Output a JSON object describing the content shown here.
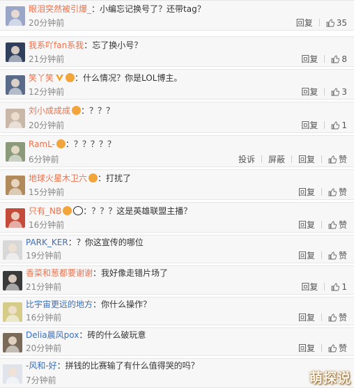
{
  "comments": [
    {
      "username": "眼泪突然被引爆_",
      "badge": "none",
      "text": "：小编忘记换号了？还带tag？",
      "time": "20分钟前",
      "actions": [
        "回复"
      ],
      "likes": "35",
      "avatar_color": "#9aa6c8",
      "avatar_icon": "anime-avatar-icon"
    },
    {
      "username": "我系吖fan系我",
      "badge": "none",
      "text": "：忘了换小号？",
      "time": "21分钟前",
      "actions": [
        "回复"
      ],
      "likes": "8",
      "avatar_color": "#2f3f5c",
      "avatar_icon": "crest-avatar-icon"
    },
    {
      "username": "笑丫笑",
      "badge": "vip",
      "text": "：什么情况？你是LOL博主。",
      "time": "12分钟前",
      "actions": [
        "回复"
      ],
      "likes": "3",
      "avatar_color": "#5a6b8a",
      "avatar_icon": "anime-avatar-icon"
    },
    {
      "username": "刘小成成成",
      "badge": "emoji",
      "text": "：？？？",
      "time": "20分钟前",
      "actions": [
        "回复"
      ],
      "likes": "1",
      "avatar_color": "#c9b8a8",
      "avatar_icon": "photo-avatar-icon"
    },
    {
      "username": "RamL-",
      "badge": "emoji",
      "text": "：？？？？？",
      "time": "6分钟前",
      "actions": [
        "投诉",
        "屏蔽",
        "回复"
      ],
      "likes": "赞",
      "avatar_color": "#8a9a7a",
      "avatar_icon": "photo-avatar-icon"
    },
    {
      "username": "地球火星木卫六",
      "badge": "emoji",
      "text": "：打扰了",
      "time": "15分钟前",
      "actions": [
        "回复"
      ],
      "likes": "赞",
      "avatar_color": "#b08a5a",
      "avatar_icon": "anime-avatar-icon"
    },
    {
      "username": "只有_NB",
      "badge": "emoji-panda",
      "text": "：？？？这是英雄联盟主播？",
      "time": "16分钟前",
      "actions": [
        "回复"
      ],
      "likes": "赞",
      "avatar_color": "#c44a3a",
      "avatar_icon": "photo-avatar-icon"
    },
    {
      "username": "PARK_KER",
      "badge": "none",
      "text": "：？你这宣传的哪位",
      "time": "19分钟前",
      "actions": [
        "回复"
      ],
      "likes": "赞",
      "avatar_color": "#d8d8d8",
      "avatar_icon": "cartoon-avatar-icon",
      "blue": true
    },
    {
      "username": "香菜和葱都要谢谢",
      "badge": "none",
      "text": "：我好像走错片场了",
      "time": "21分钟前",
      "actions": [
        "回复"
      ],
      "likes": "1",
      "avatar_color": "#3a3a3a",
      "avatar_icon": "cartoon-avatar-icon"
    },
    {
      "username": "比宇宙更远的地方",
      "badge": "none",
      "text": "：你什么操作？",
      "time": "16分钟前",
      "actions": [
        "回复"
      ],
      "likes": "赞",
      "avatar_color": "#d6cc8a",
      "avatar_icon": "anime-avatar-icon",
      "blue": true
    },
    {
      "username": "Delia晨风pox",
      "badge": "none",
      "text": "：砖的什么破玩意",
      "time": "20分钟前",
      "actions": [
        "回复"
      ],
      "likes": "赞",
      "avatar_color": "#7a6a5a",
      "avatar_icon": "photo-avatar-icon",
      "blue": true
    },
    {
      "username": "-风和-好",
      "badge": "none",
      "text": "：拼钱的比赛输了有什么值得哭的吗？",
      "time": "7分钟前",
      "actions": [],
      "likes": "",
      "avatar_color": "#e0e4ea",
      "avatar_icon": "anime-avatar-icon",
      "blue": true
    }
  ],
  "watermark": "萌探说"
}
